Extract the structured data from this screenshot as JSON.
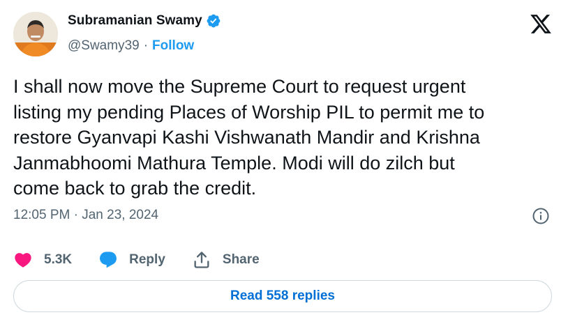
{
  "author": {
    "name": "Subramanian Swamy",
    "handle": "@Swamy39",
    "separator": "·",
    "follow_label": "Follow"
  },
  "tweet": {
    "text": "I shall now move the Supreme Court to request urgent\nlisting my pending Places of Worship PIL to permit me to\nrestore Gyanvapi Kashi Vishwanath Mandir and Krishna\nJanmabhoomi Mathura Temple. Modi will do zilch but\ncome back to grab the credit.",
    "time": "12:05 PM",
    "date_separator": "·",
    "date": "Jan 23, 2024"
  },
  "actions": {
    "likes_count": "5.3K",
    "reply_label": "Reply",
    "share_label": "Share"
  },
  "read_replies_label": "Read 558 replies",
  "icons": {
    "verified": "verified-badge-icon",
    "x_logo": "x-logo-icon",
    "info": "info-icon",
    "heart": "heart-icon",
    "reply": "reply-bubble-icon",
    "share": "share-upload-icon"
  },
  "colors": {
    "accent": "#1d9bf0",
    "link": "#006fd6",
    "heart": "#f91880",
    "muted": "#536471",
    "text": "#0f1419"
  }
}
